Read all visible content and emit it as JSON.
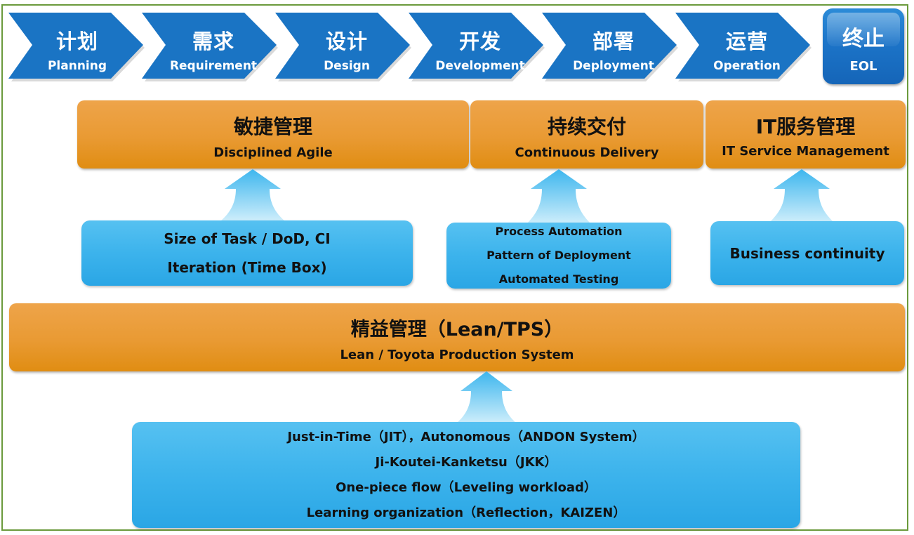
{
  "lifecycle": {
    "stages": [
      {
        "zh": "计划",
        "en": "Planning"
      },
      {
        "zh": "需求",
        "en": "Requirement"
      },
      {
        "zh": "设计",
        "en": "Design"
      },
      {
        "zh": "开发",
        "en": "Development"
      },
      {
        "zh": "部署",
        "en": "Deployment"
      },
      {
        "zh": "运营",
        "en": "Operation"
      }
    ],
    "end": {
      "zh": "终止",
      "en": "EOL"
    }
  },
  "practices": [
    {
      "zh": "敏捷管理",
      "en": "Disciplined Agile",
      "enablers": [
        "Size of Task / DoD, CI",
        "Iteration (Time Box)"
      ]
    },
    {
      "zh": "持续交付",
      "en": "Continuous Delivery",
      "enablers": [
        "Process Automation",
        "Pattern of Deployment",
        "Automated Testing"
      ]
    },
    {
      "zh": "IT服务管理",
      "en": "IT Service Management",
      "enablers": [
        "Business continuity"
      ]
    }
  ],
  "foundation": {
    "zh": "精益管理（Lean/TPS）",
    "en": "Lean / Toyota Production System",
    "principles": [
      "Just-in-Time（JIT），Autonomous（ANDON System）",
      "Ji-Koutei-Kanketsu（JKK）",
      "One-piece flow（Leveling workload）",
      "Learning organization（Reflection，KAIZEN）"
    ]
  },
  "colors": {
    "frame": "#6b9a3c",
    "chevron": "#1a74c4",
    "orange": "#e99a33",
    "blue": "#3cb3ec"
  }
}
